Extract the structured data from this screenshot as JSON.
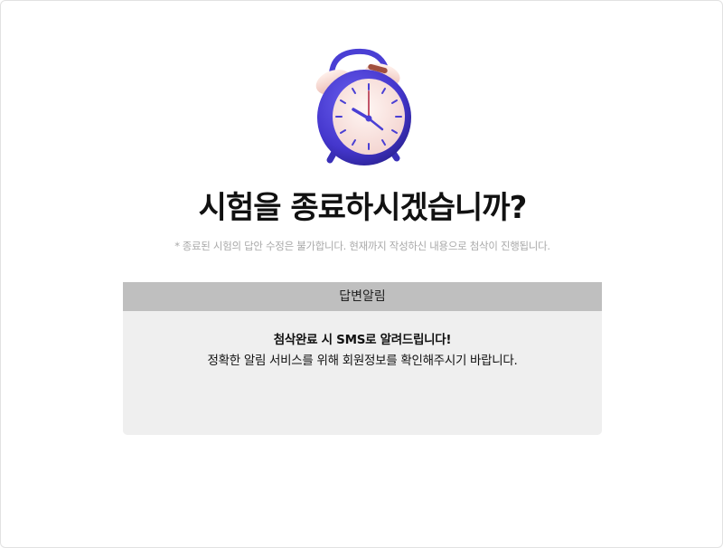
{
  "dialog": {
    "illustration": "alarm-clock-icon",
    "title": "시험을 종료하시겠습니까?",
    "notice_mark": "*",
    "notice": "종료된 시험의 답안 수정은 불가합니다. 현재까지 작성하신 내용으로 첨삭이 진행됩니다."
  },
  "panel": {
    "header": "답변알림",
    "line1": "첨삭완료 시 SMS로 알려드립니다!",
    "line2": "정확한 알림 서비스를 위해 회원정보를 확인해주시기 바랍니다."
  },
  "colors": {
    "clock_body": "#4a3fd4",
    "clock_face": "#fbe7e4",
    "clock_hands": "#4a3fd4",
    "minute_hand": "#c2566a",
    "panel_header_bg": "#bfbfbf",
    "panel_bg": "#efefef"
  }
}
